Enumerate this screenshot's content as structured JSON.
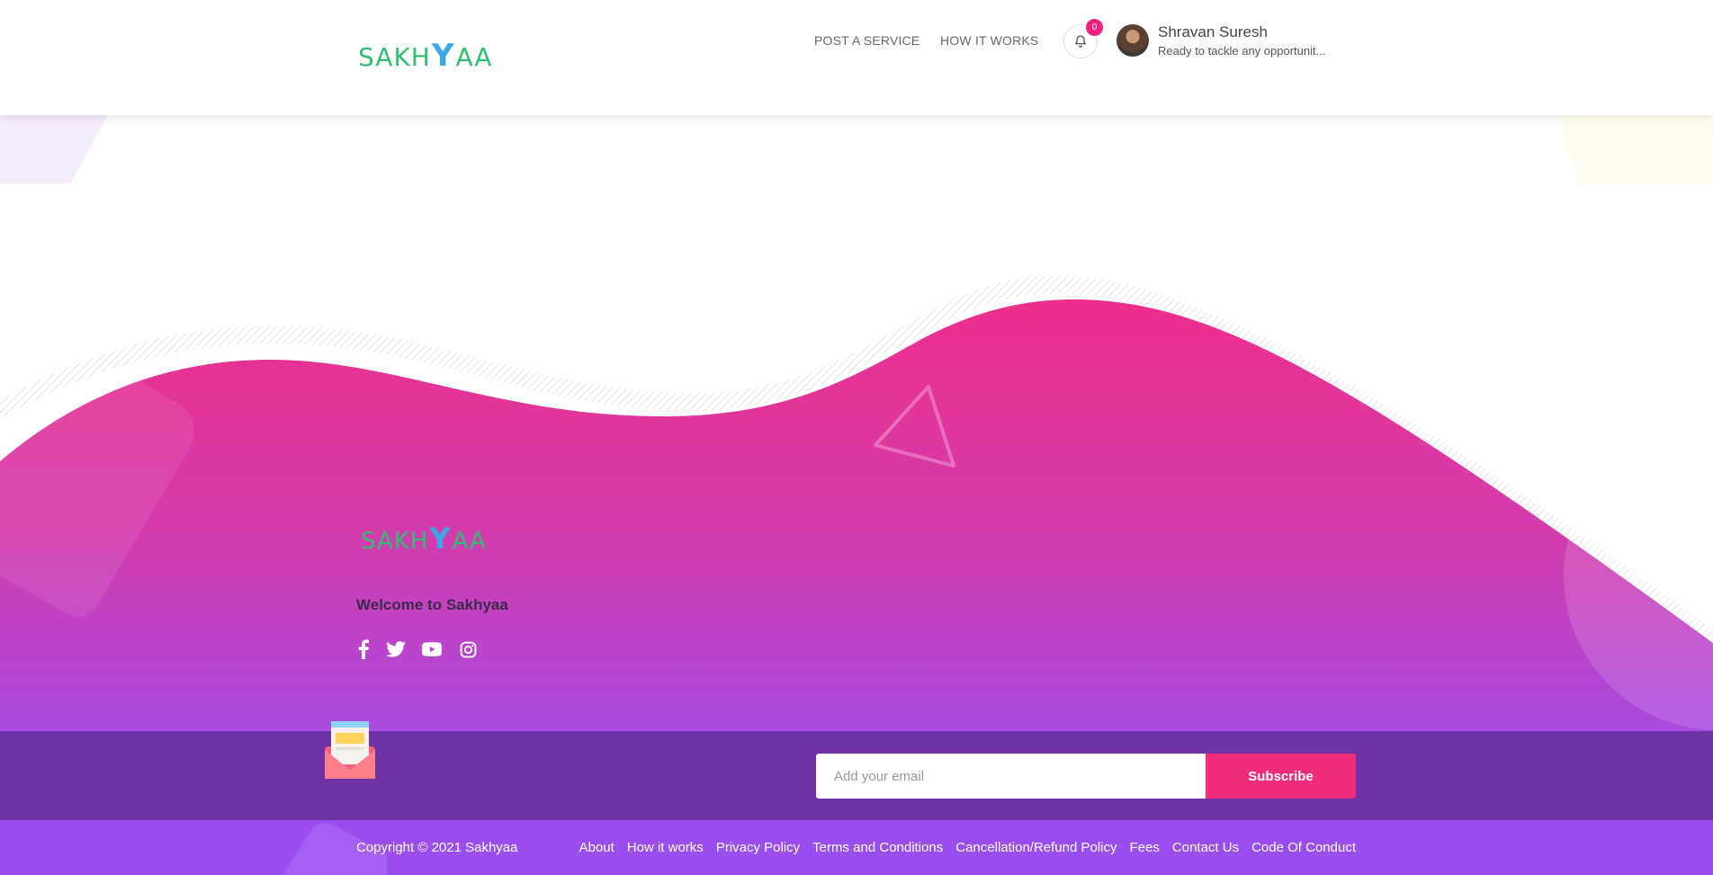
{
  "header": {
    "logo": {
      "pre": "SAKH",
      "y": "Y",
      "post": "AA"
    },
    "nav": {
      "post_service": "POST A SERVICE",
      "how_it_works": "HOW IT WORKS"
    },
    "notifications": {
      "count": "0",
      "icon": "bell-icon"
    },
    "user": {
      "name": "Shravan Suresh",
      "tagline": "Ready to tackle any opportunit..."
    }
  },
  "footer": {
    "logo": {
      "pre": "SAKH",
      "y": "Y",
      "post": "AA"
    },
    "welcome": "Welcome to Sakhyaa",
    "social": [
      "facebook-icon",
      "twitter-icon",
      "youtube-icon",
      "instagram-icon"
    ],
    "subscribe": {
      "placeholder": "Add your email",
      "button": "Subscribe"
    },
    "copyright": "Copyright © 2021 Sakhyaa",
    "links": [
      "About",
      "How it works",
      "Privacy Policy",
      "Terms and Conditions",
      "Cancellation/Refund Policy",
      "Fees",
      "Contact Us",
      "Code Of Conduct"
    ]
  },
  "colors": {
    "brand_green": "#2fbf71",
    "brand_blue": "#3aa7e8",
    "accent_pink": "#f12d7b",
    "wave_top": "#ee2f8c",
    "wave_bottom": "#a94ae0",
    "subscribe_band": "#7033a6",
    "bottom_bar": "#9b4ef0"
  }
}
